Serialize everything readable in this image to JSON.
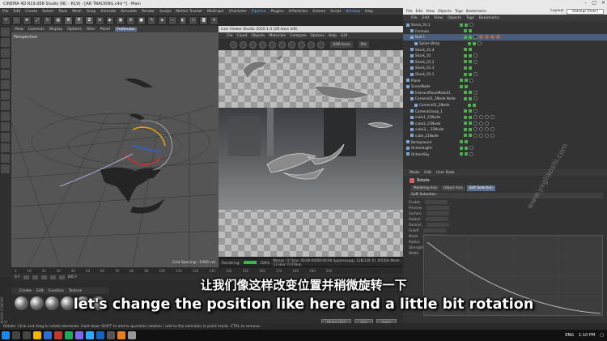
{
  "window": {
    "title": "CINEMA 4D R19.068 Studio (RC - R19) - [AR TRACKING.c4d *] - Main"
  },
  "main_menu": [
    "File",
    "Edit",
    "Create",
    "Select",
    "Tools",
    "Mesh",
    "Snap",
    "Animate",
    "Simulate",
    "Render",
    "Sculpt",
    "Motion Tracker",
    "MoGraph",
    "Character",
    "Pipeline",
    "Plugins",
    "X-Particles",
    "Octane",
    "Script",
    "Window",
    "Help"
  ],
  "main_menu_highlight": [
    "Pipeline",
    "Window"
  ],
  "toolbar": {
    "xyz": [
      "X",
      "Y",
      "Z"
    ]
  },
  "viewport": {
    "menu": [
      "View",
      "Cameras",
      "Display",
      "Options",
      "Filter",
      "Panel",
      "ProRender"
    ],
    "active_menu": "ProRender",
    "label": "Perspective",
    "grid_spacing": "Grid Spacing : 1000 cm"
  },
  "render_window": {
    "title": "Live Viewer Studio 2020.1.4 (28 days left)",
    "menu": [
      "File",
      "Cloud",
      "Objects",
      "Materials",
      "Compare",
      "Options",
      "Help",
      "GUI"
    ],
    "dropdowns": [
      "HDR tone",
      "0%"
    ],
    "status": {
      "rendering": "Rendering:",
      "percent": "100%",
      "stats": "Ms/sec: 0   Time: 00:00:00/00:00:00   Spp/maxspp: 128/128   Tri: 0/550k   Mesh: 11   Hair: 0   RTXon"
    }
  },
  "layout_bar": {
    "menu": [
      "File",
      "Edit",
      "View",
      "Objects",
      "Tags",
      "Bookmarks"
    ],
    "layout_label": "Layout:",
    "layout_value": "Startup (User)"
  },
  "object_manager": {
    "rows": [
      {
        "name": "Shark_01.1",
        "sel": false
      },
      {
        "name": "Formula",
        "sel": false
      },
      {
        "name": "Null.1",
        "sel": true
      },
      {
        "name": "Spline Wrap",
        "sel": false
      },
      {
        "name": "Shark_01.4",
        "sel": false
      },
      {
        "name": "Shark_01",
        "sel": false
      },
      {
        "name": "Shark_01.2",
        "sel": false
      },
      {
        "name": "Shark_01.3",
        "sel": false
      },
      {
        "name": "Shark_01.1",
        "sel": false
      },
      {
        "name": "Plane",
        "sel": false
      },
      {
        "name": "SceneNode",
        "sel": false
      },
      {
        "name": "InteractPlaneMask01",
        "sel": false
      },
      {
        "name": "Camera01_2Node Node",
        "sel": false
      },
      {
        "name": "Camera01_2Node",
        "sel": false
      },
      {
        "name": "CameraGroup_1",
        "sel": false
      },
      {
        "name": "cube1_21Node",
        "sel": false
      },
      {
        "name": "cube2_21Node",
        "sel": false
      },
      {
        "name": "cube3_...21Node",
        "sel": false
      },
      {
        "name": "cube_21Node",
        "sel": false
      },
      {
        "name": "Background",
        "sel": false
      },
      {
        "name": "OctaneLight",
        "sel": false
      },
      {
        "name": "OctaneSky",
        "sel": false
      }
    ]
  },
  "attribute_manager": {
    "tabs": [
      "Mode",
      "Edit",
      "User Data"
    ],
    "object_name": "Rotate",
    "subtabs": [
      "Modeling Axis",
      "Object Axis",
      "Soft Selection"
    ],
    "active_subtab": "Soft Selection",
    "section": "Soft Selection",
    "params": [
      {
        "label": "Enable"
      },
      {
        "label": "Preview"
      },
      {
        "label": "Surface"
      },
      {
        "label": "Rubber"
      },
      {
        "label": "Restrict"
      },
      {
        "label": "Falloff"
      },
      {
        "label": "Mode"
      },
      {
        "label": "Radius"
      },
      {
        "label": "Strength"
      },
      {
        "label": "Width"
      }
    ]
  },
  "timeline": {
    "ticks": [
      "0",
      "10",
      "20",
      "30",
      "40",
      "50",
      "60",
      "70",
      "80",
      "90",
      "100",
      "110",
      "120",
      "130",
      "140",
      "150",
      "160",
      "170",
      "180",
      "190",
      "200"
    ],
    "start": "0 F",
    "end": "205 F"
  },
  "material_manager": {
    "menu": [
      "Create",
      "Edit",
      "Function",
      "Texture"
    ]
  },
  "coordinates": {
    "buttons": [
      "Object (Rel)",
      "Size",
      "Apply"
    ]
  },
  "subtitles": {
    "chinese": "让我们像这样改变位置并稍微旋转一下",
    "english": "let's change the position like here and a little bit rotation"
  },
  "watermark": "www.yxgliaoshi.com",
  "maxon_label": "MAXON CINEMA 4D",
  "statusbar": {
    "text": "Rotate: Click and drag to rotate elements. Hold down SHIFT to add to quantize rotation / add to the selection in point mode. CTRL to remove."
  },
  "taskbar": {
    "time": "1:10 PM",
    "lang": "ENG"
  }
}
